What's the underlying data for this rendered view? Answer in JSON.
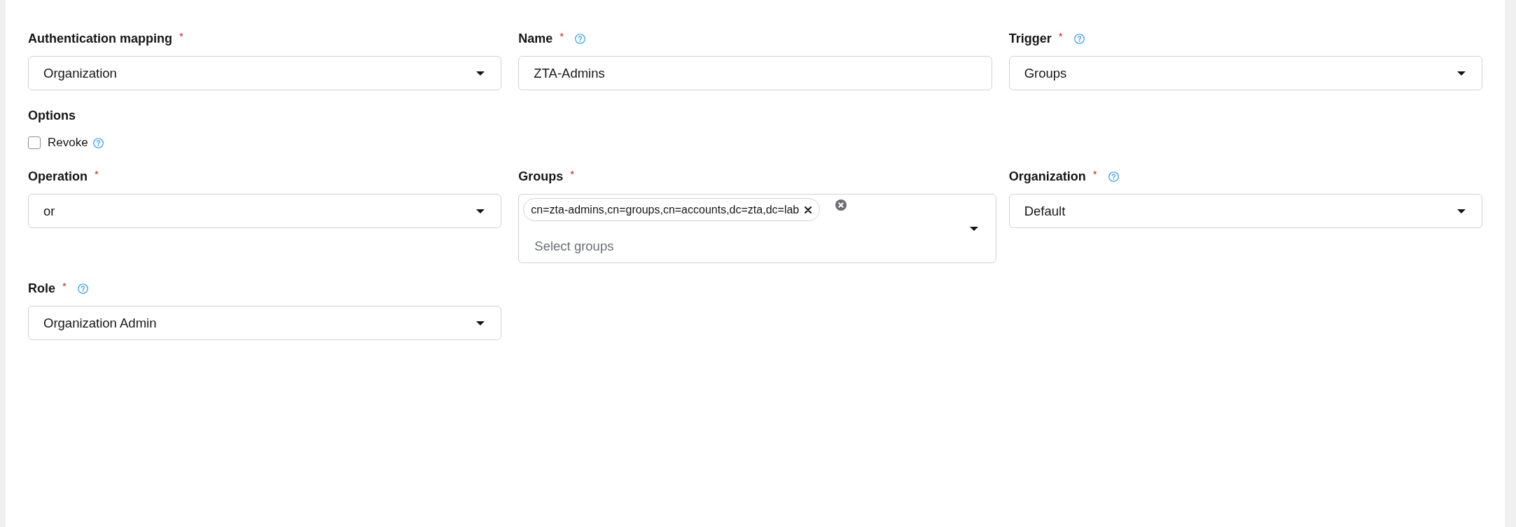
{
  "form": {
    "items": [
      {
        "kind": "select",
        "label": "Authentication mapping",
        "required_mark": "*",
        "help": false,
        "value": "Organization"
      },
      {
        "kind": "text",
        "label": "Name",
        "required_mark": "*",
        "help": true,
        "value": "ZTA-Admins"
      },
      {
        "kind": "select",
        "label": "Trigger",
        "required_mark": "*",
        "help": true,
        "value": "Groups"
      },
      {
        "kind": "options",
        "label": "Options",
        "checkboxes": [
          {
            "label": "Revoke",
            "checked": false,
            "help": true
          }
        ]
      },
      {
        "kind": "select",
        "label": "Operation",
        "required_mark": "*",
        "help": false,
        "value": "or"
      },
      {
        "kind": "multiselect",
        "label": "Groups",
        "required_mark": "*",
        "help": false,
        "chips": [
          "cn=zta-admins,cn=groups,cn=accounts,dc=zta,dc=lab"
        ],
        "placeholder": "Select groups"
      },
      {
        "kind": "select",
        "label": "Organization",
        "required_mark": "*",
        "help": true,
        "value": "Default"
      },
      {
        "kind": "select",
        "label": "Role",
        "required_mark": "*",
        "help": true,
        "value": "Organization Admin"
      }
    ]
  }
}
